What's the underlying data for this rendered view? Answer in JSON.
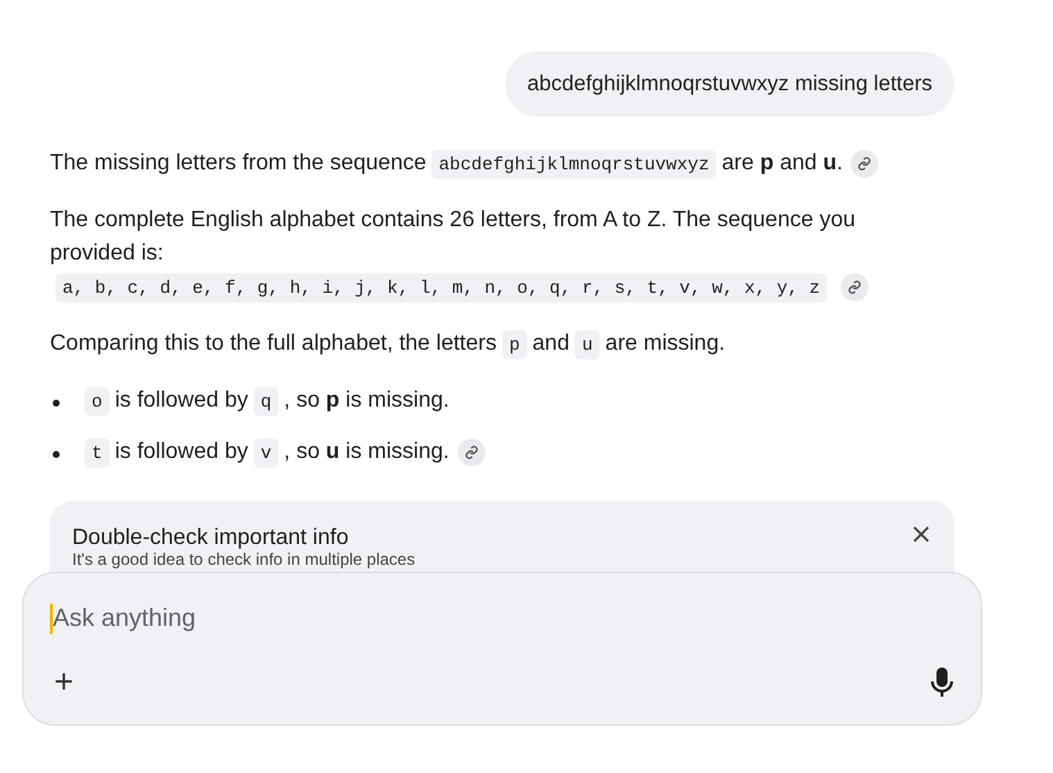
{
  "user_message": "abcdefghijklmnoqrstuvwxyz missing letters",
  "blocks": [
    {
      "kind": "paragraph",
      "parts": [
        {
          "kind": "text",
          "text": "The missing letters from the sequence"
        },
        {
          "kind": "code",
          "text": "abcdefghijklmnoqrstuvwxyz"
        },
        {
          "kind": "text",
          "text": "are **p** and **u**."
        },
        {
          "kind": "source"
        }
      ]
    },
    {
      "kind": "paragraph",
      "parts": [
        {
          "kind": "text",
          "text": "The complete English alphabet contains 26 letters, from A to Z. The sequence you"
        },
        {
          "kind": "break"
        },
        {
          "kind": "text",
          "text": "provided is:"
        },
        {
          "kind": "break"
        },
        {
          "kind": "code",
          "text": "a, b, c, d, e, f, g, h, i, j, k, l, m, n, o, q, r, s, t, v, w, x, y, z"
        },
        {
          "kind": "source"
        }
      ]
    },
    {
      "kind": "paragraph",
      "parts": [
        {
          "kind": "text",
          "text": "Comparing this to the full alphabet, the letters"
        },
        {
          "kind": "code",
          "text": "p"
        },
        {
          "kind": "text",
          "text": "and"
        },
        {
          "kind": "code",
          "text": "u"
        },
        {
          "kind": "text",
          "text": "are missing."
        }
      ]
    },
    {
      "kind": "bullets",
      "items": [
        {
          "parts": [
            {
              "kind": "code",
              "text": "o"
            },
            {
              "kind": "text",
              "text": "is followed by"
            },
            {
              "kind": "code",
              "text": "q"
            },
            {
              "kind": "text",
              "text": ", so **p** is missing."
            }
          ]
        },
        {
          "parts": [
            {
              "kind": "code",
              "text": "t"
            },
            {
              "kind": "text",
              "text": "is followed by"
            },
            {
              "kind": "code",
              "text": "v"
            },
            {
              "kind": "text",
              "text": ", so **u** is missing."
            },
            {
              "kind": "source"
            }
          ]
        }
      ]
    }
  ],
  "notice": {
    "title": "Double-check important info",
    "text": "It's a good idea to check info in multiple places"
  },
  "composer": {
    "placeholder": "Ask anything",
    "add": "+"
  }
}
